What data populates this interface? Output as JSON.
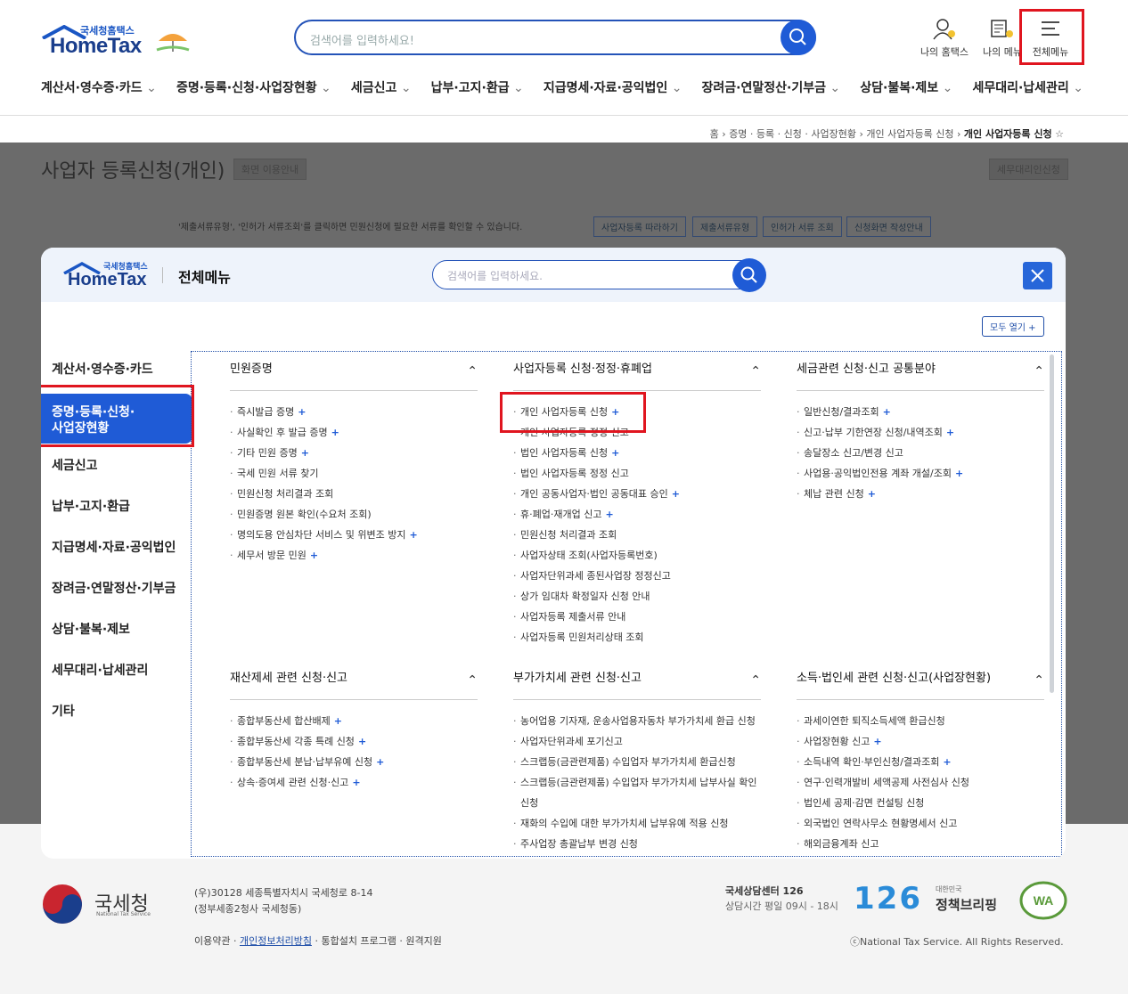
{
  "header": {
    "logo_sub": "국세청홈택스",
    "logo_main": "HomeTax",
    "search_placeholder": "검색어를 입력하세요!",
    "my_hometax": "나의 홈택스",
    "my_menu": "나의 메뉴",
    "all_menu": "전체메뉴",
    "gnb": [
      "계산서·영수증·카드",
      "증명·등록·신청·사업장현황",
      "세금신고",
      "납부·고지·환급",
      "지급명세·자료·공익법인",
      "장려금·연말정산·기부금",
      "상담·불복·제보",
      "세무대리·납세관리"
    ]
  },
  "breadcrumb": [
    "홈",
    "증명 · 등록 · 신청 · 사업장현황",
    "개인 사업자등록 신청",
    "개인 사업자등록 신청"
  ],
  "page": {
    "title": "사업자 등록신청(개인)",
    "guide_btn": "화면 이용안내",
    "agent_btn": "세무대리인신청",
    "notice": "'제출서류유형', '인허가 서류조회'를 클릭하면 민원신청에 필요한 서류를 확인할 수 있습니다.",
    "buttons": [
      "사업자등록 따라하기",
      "제출서류유형",
      "인허가 서류 조회",
      "신청화면 작성안내"
    ]
  },
  "modal": {
    "title": "전체메뉴",
    "search_placeholder": "검색어를 입력하세요.",
    "open_all": "모두 열기 +",
    "left_nav": [
      "계산서·영수증·카드",
      "증명·등록·신청·\n사업장현황",
      "세금신고",
      "납부·고지·환급",
      "지급명세·자료·공익법인",
      "장려금·연말정산·기부금",
      "상담·불복·제보",
      "세무대리·납세관리",
      "기타"
    ],
    "sections": [
      {
        "title": "민원증명",
        "items": [
          [
            "즉시발급 증명",
            true
          ],
          [
            "사실확인 후 발급 증명",
            true
          ],
          [
            "기타 민원 증명",
            true
          ],
          [
            "국세 민원 서류 찾기",
            false
          ],
          [
            "민원신청 처리결과 조회",
            false
          ],
          [
            "민원증명 원본 확인(수요처 조회)",
            false
          ],
          [
            "명의도용 안심차단 서비스 및 위변조 방지",
            true
          ],
          [
            "세무서 방문 민원",
            true
          ]
        ]
      },
      {
        "title": "사업자등록 신청·정정·휴폐업",
        "items": [
          [
            "개인 사업자등록 신청",
            true
          ],
          [
            "개인 사업자등록 정정 신고",
            false
          ],
          [
            "법인 사업자등록 신청",
            true
          ],
          [
            "법인 사업자등록 정정 신고",
            false
          ],
          [
            "개인 공동사업자·법인 공동대표 승인",
            true
          ],
          [
            "휴·폐업·재개업 신고",
            true
          ],
          [
            "민원신청 처리결과 조회",
            false
          ],
          [
            "사업자상태 조회(사업자등록번호)",
            false
          ],
          [
            "사업자단위과세 종된사업장 정정신고",
            false
          ],
          [
            "상가 임대차 확정일자 신청 안내",
            false
          ],
          [
            "사업자등록 제출서류 안내",
            false
          ],
          [
            "사업자등록 민원처리상태 조회",
            false
          ]
        ]
      },
      {
        "title": "세금관련 신청·신고 공통분야",
        "items": [
          [
            "일반신청/결과조회",
            true
          ],
          [
            "신고·납부 기한연장 신청/내역조회",
            true
          ],
          [
            "송달장소 신고/변경 신고",
            false
          ],
          [
            "사업용·공익법인전용 계좌 개설/조회",
            true
          ],
          [
            "체납 관련 신청",
            true
          ]
        ]
      },
      {
        "title": "재산제세 관련 신청·신고",
        "items": [
          [
            "종합부동산세 합산배제",
            true
          ],
          [
            "종합부동산세 각종 특례 신청",
            true
          ],
          [
            "종합부동산세 분납·납부유예 신청",
            true
          ],
          [
            "상속·증여세 관련 신청·신고",
            true
          ]
        ]
      },
      {
        "title": "부가가치세 관련 신청·신고",
        "items": [
          [
            "농어업용 기자재, 운송사업용자동차 부가가치세 환급 신청",
            false
          ],
          [
            "사업자단위과세 포기신고",
            false
          ],
          [
            "스크랩등(금관련제품) 수입업자 부가가치세 환급신청",
            false
          ],
          [
            "스크랩등(금관련제품) 수입업자 부가가치세 납부사실 확인신청",
            false
          ],
          [
            "재화의 수입에 대한 부가가치세 납부유예 적용 신청",
            false
          ],
          [
            "주사업장 총괄납부 변경 신청",
            false
          ]
        ]
      },
      {
        "title": "소득·법인세 관련 신청·신고(사업장현황)",
        "items": [
          [
            "과세이연한 퇴직소득세액 환급신청",
            false
          ],
          [
            "사업장현황 신고",
            true
          ],
          [
            "소득내역 확인·부인신청/결과조회",
            true
          ],
          [
            "연구·인력개발비 세액공제 사전심사 신청",
            false
          ],
          [
            "법인세 공제·감면 컨설팅 신청",
            false
          ],
          [
            "외국법인 연락사무소 현황명세서 신고",
            false
          ],
          [
            "해외금융계좌 신고",
            false
          ]
        ]
      }
    ]
  },
  "footer": {
    "org": "국세청",
    "org_en": "National Tax Service",
    "addr1": "(우)30128 세종특별자치시 국세청로 8-14",
    "addr2": "(정부세종2청사 국세청동)",
    "links": [
      "이용약관",
      "개인정보처리방침",
      "통합설치 프로그램",
      "원격지원"
    ],
    "center": "국세상담센터 126",
    "hours": "상담시간 평일 09시 - 18시",
    "copyright": "ⓒNational Tax Service. All Rights Reserved.",
    "num126": "126",
    "briefing": "정책브리핑",
    "briefing_sub": "대한민국"
  }
}
